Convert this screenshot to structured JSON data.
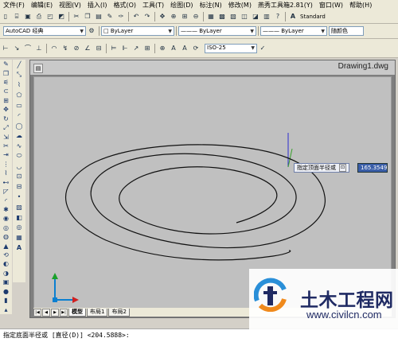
{
  "menu": [
    "文件(F)",
    "编辑(E)",
    "视图(V)",
    "插入(I)",
    "格式(O)",
    "工具(T)",
    "绘图(D)",
    "标注(N)",
    "修改(M)",
    "燕秀工具箱2.81(Y)",
    "窗口(W)",
    "帮助(H)"
  ],
  "toolbar_text": {
    "style": "Standard",
    "workspace": "AutoCAD 经典",
    "layer_color": "ByLayer",
    "layer_linetype": "ByLayer",
    "layer_lineweight": "ByLayer",
    "plot_style": "随颜色",
    "dim_style": "ISO-25"
  },
  "drawing": {
    "title": "Drawing1.dwg"
  },
  "tabs": [
    "模型",
    "布局1",
    "布局2"
  ],
  "prompt": {
    "label": "指定顶面半径或",
    "value": "165.3549",
    "dropdown": "⊡"
  },
  "command_line": "指定底面半径或 [直径(D)] <204.5888>:",
  "watermark": {
    "title": "土木工程网",
    "url": "www.civilcn.com"
  },
  "icons": {
    "toolbar1": [
      "new-icon",
      "open-icon",
      "save-icon",
      "print-icon",
      "preview-icon",
      "publish-icon",
      "cut-icon",
      "copy-icon",
      "paste-icon",
      "match-icon",
      "brush-icon",
      "undo-icon",
      "redo-icon",
      "pan-icon",
      "zoom-realtime-icon",
      "zoom-window-icon",
      "zoom-previous-icon",
      "properties-icon",
      "design-center-icon",
      "tool-palette-icon",
      "sheet-set-icon",
      "markup-icon",
      "calculator-icon",
      "help-icon"
    ],
    "draw_left": [
      "line-icon",
      "construction-line-icon",
      "polyline-icon",
      "polygon-icon",
      "rectangle-icon",
      "arc-icon",
      "circle-icon",
      "revision-cloud-icon",
      "spline-icon",
      "ellipse-icon",
      "ellipse-arc-icon",
      "insert-block-icon",
      "make-block-icon",
      "point-icon",
      "hatch-icon",
      "gradient-icon",
      "region-icon",
      "table-icon",
      "mtext-icon"
    ]
  },
  "colors": {
    "accent": "#3a5ea8",
    "canvas": "#c0c0c0",
    "window": "#7f7f7f"
  }
}
